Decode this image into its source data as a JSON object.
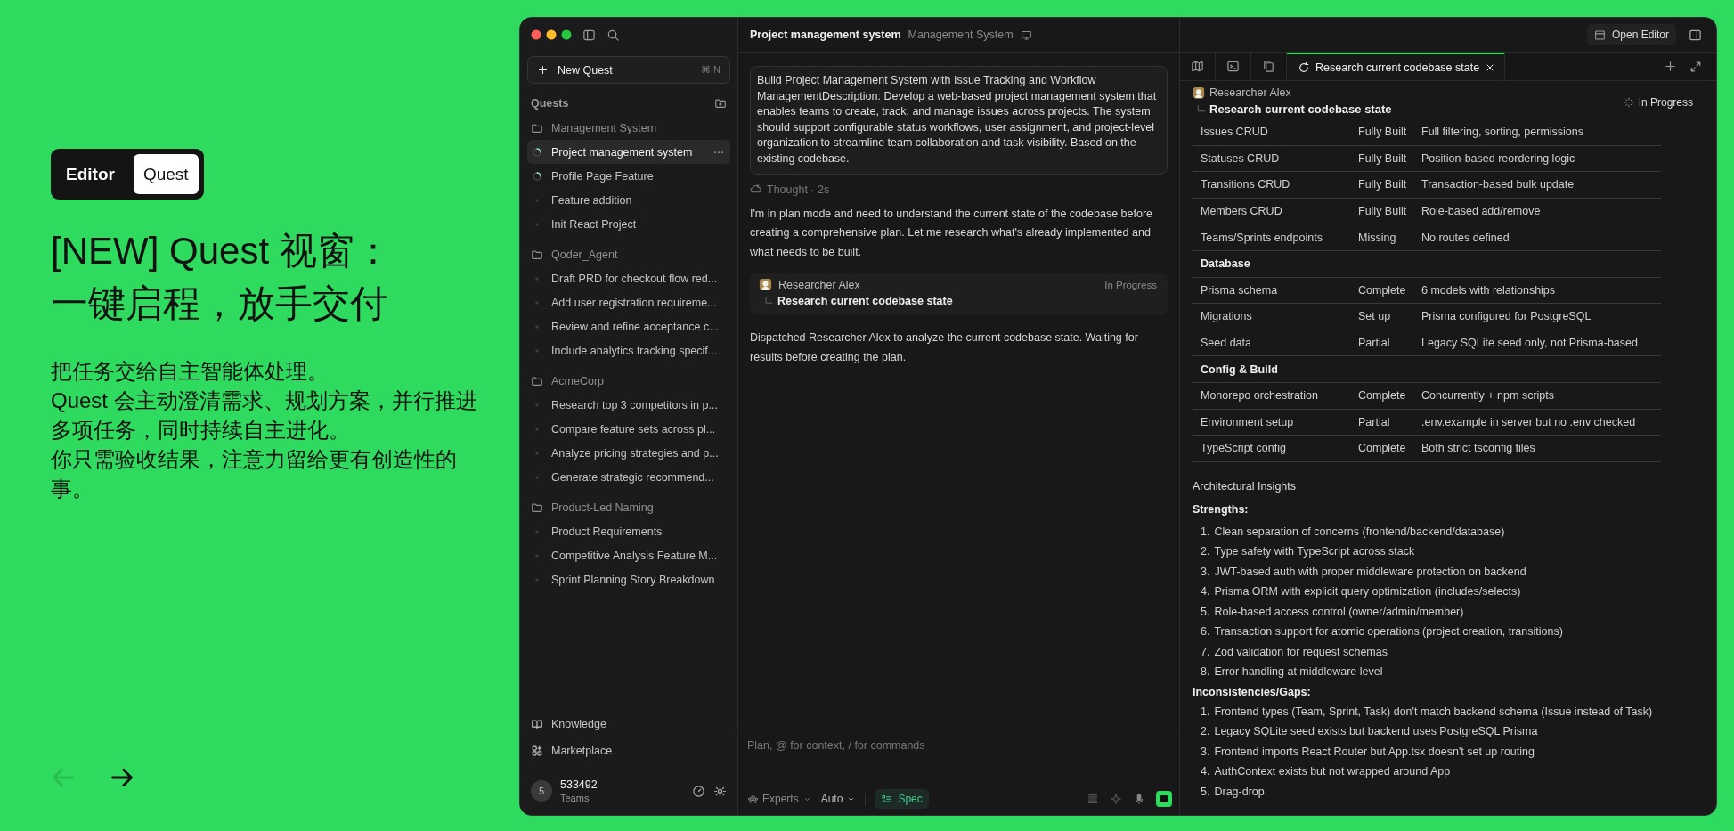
{
  "promo": {
    "mode_toggle": [
      {
        "label": "Editor",
        "selected": false
      },
      {
        "label": "Quest",
        "selected": true
      }
    ],
    "headline_lines": [
      "[NEW] Quest 视窗：",
      "一键启程，放手交付"
    ],
    "body_paragraphs": [
      "把任务交给自主智能体处理。",
      "Quest 会主动澄清需求、规划方案，并行推进多项任务，同时持续自主进化。",
      "你只需验收结果，注意力留给更有创造性的事。"
    ],
    "nav": [
      {
        "kind": "back",
        "disabled": true
      },
      {
        "kind": "forward",
        "disabled": false
      }
    ]
  },
  "sidebar": {
    "new_quest": {
      "label": "New Quest",
      "shortcut": "⌘ N"
    },
    "section_title": "Quests",
    "groups": [
      {
        "name": "Management System",
        "items": [
          {
            "label": "Project management system",
            "kind": "running",
            "selected": true
          },
          {
            "label": "Profile Page Feature",
            "kind": "running",
            "selected": false
          },
          {
            "label": "Feature addition",
            "kind": "idle",
            "selected": false
          },
          {
            "label": "Init React Project",
            "kind": "idle",
            "selected": false
          }
        ]
      },
      {
        "name": "Qoder_Agent",
        "items": [
          {
            "label": "Draft PRD for checkout flow red...",
            "kind": "idle",
            "selected": false
          },
          {
            "label": "Add user registration requireme...",
            "kind": "idle",
            "selected": false
          },
          {
            "label": "Review and refine acceptance c...",
            "kind": "idle",
            "selected": false
          },
          {
            "label": "Include analytics tracking specif...",
            "kind": "idle",
            "selected": false
          }
        ]
      },
      {
        "name": "AcmeCorp",
        "items": [
          {
            "label": "Research top 3 competitors in p...",
            "kind": "idle",
            "selected": false
          },
          {
            "label": "Compare feature sets across pl...",
            "kind": "idle",
            "selected": false
          },
          {
            "label": "Analyze pricing strategies and p...",
            "kind": "idle",
            "selected": false
          },
          {
            "label": "Generate strategic recommend...",
            "kind": "idle",
            "selected": false
          }
        ]
      },
      {
        "name": "Product-Led Naming",
        "items": [
          {
            "label": "Product Requirements",
            "kind": "idle",
            "selected": false
          },
          {
            "label": "Competitive Analysis Feature M...",
            "kind": "idle",
            "selected": false
          },
          {
            "label": "Sprint Planning Story Breakdown",
            "kind": "idle",
            "selected": false
          }
        ]
      }
    ],
    "footer_links": [
      {
        "kind": "knowledge",
        "label": "Knowledge"
      },
      {
        "kind": "marketplace",
        "label": "Marketplace"
      }
    ],
    "user": {
      "avatar": "5",
      "name": "533492",
      "team": "Teams"
    }
  },
  "chat": {
    "title": "Project management system",
    "subtitle": "Management System",
    "prompt": "Build Project Management System with Issue Tracking and Workflow ManagementDescription: Develop a web-based project management system that enables teams to create, track, and manage issues across projects. The system should support configurable status workflows, user assignment, and project-level organization to streamline team collaboration and task visibility. Based on the existing codebase.",
    "thought": "Thought · 2s",
    "messages": [
      {
        "kind": "text",
        "text": "I'm in plan mode and need to understand the current state of the codebase before creating a comprehensive plan. Let me research what's already implemented and what needs to be built."
      },
      {
        "kind": "agent",
        "name": "Researcher Alex",
        "status": "In Progress",
        "task": "Research current codebase state"
      },
      {
        "kind": "text",
        "text": "Dispatched Researcher Alex to analyze the current codebase state. Waiting for results before creating the plan."
      }
    ],
    "composer": {
      "placeholder": "Plan, @ for context, / for commands",
      "experts": "Experts",
      "mode": "Auto",
      "spec": {
        "label": "Spec",
        "selected": true
      }
    }
  },
  "detail": {
    "open_editor": "Open Editor",
    "tabs": [
      {
        "label": "Research current codebase state",
        "selected": true
      }
    ],
    "agent": {
      "name": "Researcher Alex",
      "task": "Research current codebase state",
      "status": "In Progress"
    },
    "table_rows": [
      {
        "kind": "row",
        "cells": [
          "Issues CRUD",
          "Fully Built",
          "Full filtering, sorting, permissions"
        ]
      },
      {
        "kind": "row",
        "cells": [
          "Statuses CRUD",
          "Fully Built",
          "Position-based reordering logic"
        ]
      },
      {
        "kind": "row",
        "cells": [
          "Transitions CRUD",
          "Fully Built",
          "Transaction-based bulk update"
        ]
      },
      {
        "kind": "row",
        "cells": [
          "Members CRUD",
          "Fully Built",
          "Role-based add/remove"
        ]
      },
      {
        "kind": "row",
        "cells": [
          "Teams/Sprints endpoints",
          "Missing",
          "No routes defined"
        ]
      },
      {
        "kind": "section",
        "label": "Database"
      },
      {
        "kind": "row",
        "cells": [
          "Prisma schema",
          "Complete",
          "6 models with relationships"
        ]
      },
      {
        "kind": "row",
        "cells": [
          "Migrations",
          "Set up",
          "Prisma configured for PostgreSQL"
        ]
      },
      {
        "kind": "row",
        "cells": [
          "Seed data",
          "Partial",
          "Legacy SQLite seed only, not Prisma-based"
        ]
      },
      {
        "kind": "section",
        "label": "Config & Build"
      },
      {
        "kind": "row",
        "cells": [
          "Monorepo orchestration",
          "Complete",
          "Concurrently + npm scripts"
        ]
      },
      {
        "kind": "row",
        "cells": [
          "Environment setup",
          "Partial",
          ".env.example in server but no .env checked"
        ]
      },
      {
        "kind": "row",
        "cells": [
          "TypeScript config",
          "Complete",
          "Both strict tsconfig files"
        ]
      }
    ],
    "insights_title": "Architectural Insights",
    "lists": [
      {
        "heading": "Strengths:",
        "items": [
          {
            "number": "1.",
            "text": "Clean separation of concerns (frontend/backend/database)"
          },
          {
            "number": "2.",
            "text": "Type safety with TypeScript across stack"
          },
          {
            "number": "3.",
            "text": "JWT-based auth with proper middleware protection on backend"
          },
          {
            "number": "4.",
            "text": "Prisma ORM with explicit query optimization (includes/selects)"
          },
          {
            "number": "5.",
            "text": "Role-based access control (owner/admin/member)"
          },
          {
            "number": "6.",
            "text": "Transaction support for atomic operations (project creation, transitions)"
          },
          {
            "number": "7.",
            "text": "Zod validation for request schemas"
          },
          {
            "number": "8.",
            "text": "Error handling at middleware level"
          }
        ]
      },
      {
        "heading": "Inconsistencies/Gaps:",
        "items": [
          {
            "number": "1.",
            "text": "Frontend types (Team, Sprint, Task) don't match backend schema (Issue instead of Task)"
          },
          {
            "number": "2.",
            "text": "Legacy SQLite seed exists but backend uses PostgreSQL Prisma"
          },
          {
            "number": "3.",
            "text": "Frontend imports React Router but App.tsx doesn't set up routing"
          },
          {
            "number": "4.",
            "text": "AuthContext exists but not wrapped around App"
          },
          {
            "number": "5.",
            "text": "Drag-drop"
          }
        ]
      }
    ]
  }
}
